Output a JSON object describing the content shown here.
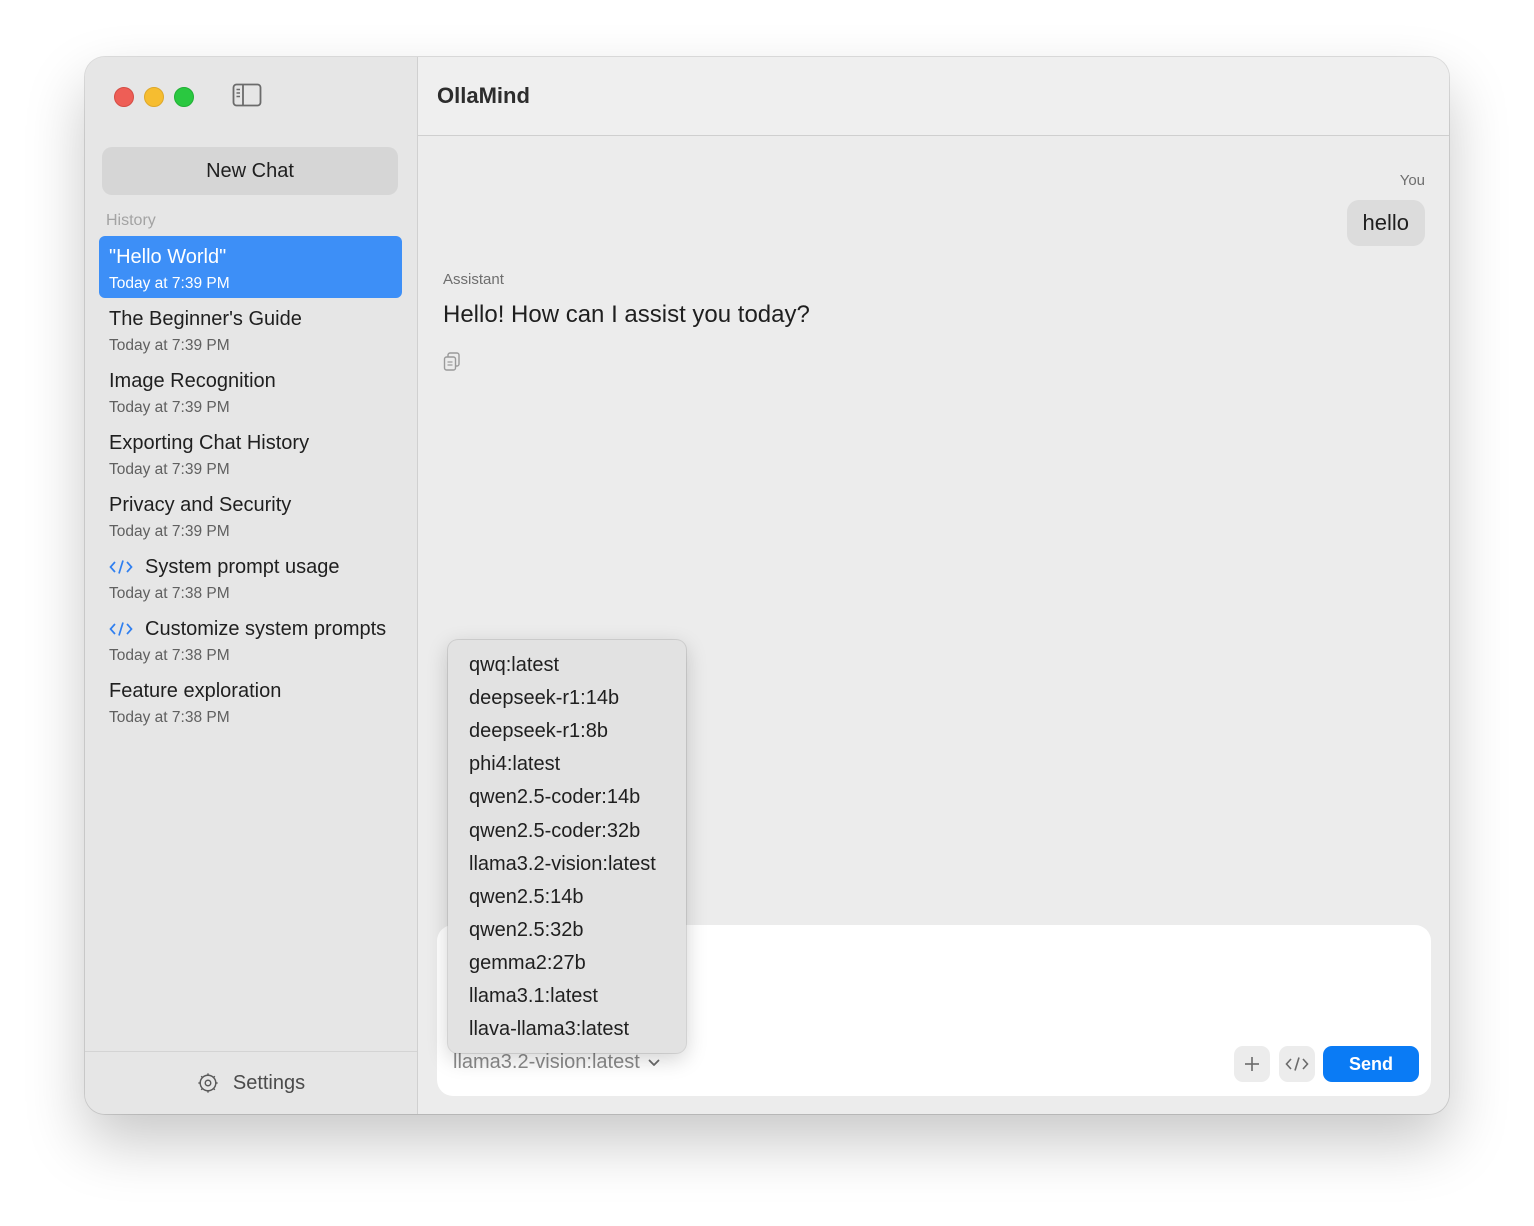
{
  "app": {
    "title": "OllaMind"
  },
  "sidebar": {
    "new_chat_label": "New Chat",
    "section_label": "History",
    "items": [
      {
        "title": "\"Hello World\"",
        "time": "Today at 7:39 PM",
        "selected": true,
        "icon": ""
      },
      {
        "title": "The Beginner's Guide",
        "time": "Today at 7:39 PM",
        "icon": ""
      },
      {
        "title": "Image Recognition",
        "time": "Today at 7:39 PM",
        "icon": ""
      },
      {
        "title": "Exporting Chat History",
        "time": "Today at 7:39 PM",
        "icon": ""
      },
      {
        "title": "Privacy and Security",
        "time": "Today at 7:39 PM",
        "icon": ""
      },
      {
        "title": "System prompt usage",
        "time": "Today at 7:38 PM",
        "icon": "code-icon"
      },
      {
        "title": "Customize system prompts",
        "time": "Today at 7:38 PM",
        "icon": "code-icon"
      },
      {
        "title": "Feature exploration",
        "time": "Today at 7:38 PM",
        "icon": ""
      }
    ],
    "settings_label": "Settings"
  },
  "conversation": {
    "user_label": "You",
    "user_message": "hello",
    "assistant_label": "Assistant",
    "assistant_message": "Hello! How can I assist you today?"
  },
  "composer": {
    "selected_model": "llama3.2-vision:latest",
    "send_label": "Send"
  },
  "model_menu": {
    "options": [
      "qwq:latest",
      "deepseek-r1:14b",
      "deepseek-r1:8b",
      "phi4:latest",
      "qwen2.5-coder:14b",
      "qwen2.5-coder:32b",
      "llama3.2-vision:latest",
      "qwen2.5:14b",
      "qwen2.5:32b",
      "gemma2:27b",
      "llama3.1:latest",
      "llava-llama3:latest"
    ]
  },
  "colors": {
    "accent": "#0a7bf5",
    "selection": "#3d8ff7",
    "close": "#ee5e56",
    "minimize": "#f6bd30",
    "maximize": "#2ac840"
  }
}
